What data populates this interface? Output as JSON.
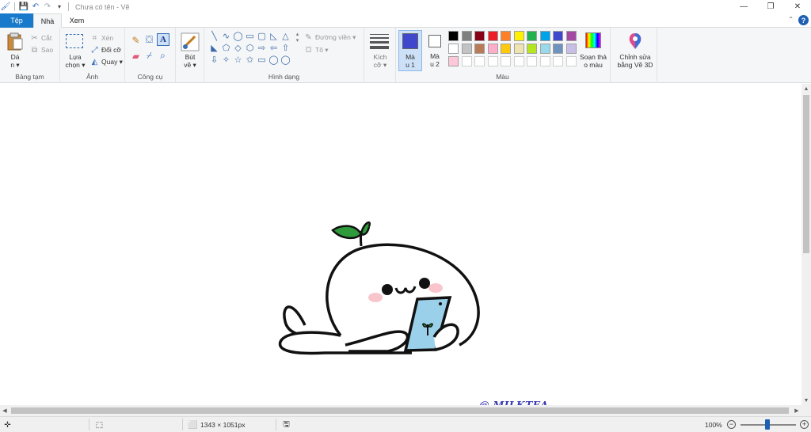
{
  "window": {
    "title": "Chưa có tên - Vẽ",
    "controls": {
      "minimize": "—",
      "restore": "❐",
      "close": "✕"
    }
  },
  "tabs": {
    "file": "Tệp",
    "home": "Nhà",
    "view": "Xem"
  },
  "ribbon": {
    "clipboard": {
      "label": "Bảng tạm",
      "paste_line1": "Dá",
      "paste_line2": "n ▾",
      "cut": "Cắt",
      "copy": "Sao"
    },
    "image": {
      "label": "Ảnh",
      "select_line1": "Lựa",
      "select_line2": "chọn ▾",
      "crop": "Xén",
      "resize": "Đổi cỡ",
      "rotate": "Quay ▾"
    },
    "tools": {
      "label": "Công cụ"
    },
    "brushes": {
      "line1": "Bút",
      "line2": "vẽ ▾"
    },
    "shapes": {
      "label": "Hình dạng",
      "outline": "Đường viền ▾",
      "fill": "Tô ▾",
      "glyphs": [
        "╲",
        "∿",
        "◯",
        "▭",
        "▢",
        "◺",
        "△",
        "◣",
        "⬠",
        "◇",
        "⬡",
        "⇨",
        "⇦",
        "⇧",
        "⇩",
        "✧",
        "☆",
        "✩",
        "▭",
        "◯",
        "◯"
      ]
    },
    "size": {
      "line1": "Kích",
      "line2": "cỡ ▾"
    },
    "color1": {
      "line1": "Mà",
      "line2": "u 1",
      "value": "#3f48cc"
    },
    "color2": {
      "line1": "Mà",
      "line2": "u 2",
      "value": "#ffffff"
    },
    "colors": {
      "label": "Màu",
      "row1": [
        "#000000",
        "#7f7f7f",
        "#880015",
        "#ed1c24",
        "#ff7f27",
        "#fff200",
        "#22b14c",
        "#00a2e8",
        "#3f48cc",
        "#a349a4"
      ],
      "row2": [
        "#ffffff",
        "#c3c3c3",
        "#b97a57",
        "#ffaec9",
        "#ffc90e",
        "#efe4b0",
        "#b5e61d",
        "#99d9ea",
        "#7092be",
        "#c8bfe7"
      ],
      "row3": [
        "#ffc8d8",
        "#ffffff",
        "#ffffff",
        "#ffffff",
        "#ffffff",
        "#ffffff",
        "#ffffff",
        "#ffffff",
        "#ffffff",
        "#ffffff"
      ]
    },
    "edit_colors": {
      "line1": "Soạn thả",
      "line2": "o màu"
    },
    "paint3d": {
      "line1": "Chỉnh sửa",
      "line2": "bằng Vẽ 3D"
    }
  },
  "canvas": {
    "watermark": "@ MILKTEA"
  },
  "status": {
    "dimensions": "1343 × 1051px",
    "zoom": "100%"
  }
}
